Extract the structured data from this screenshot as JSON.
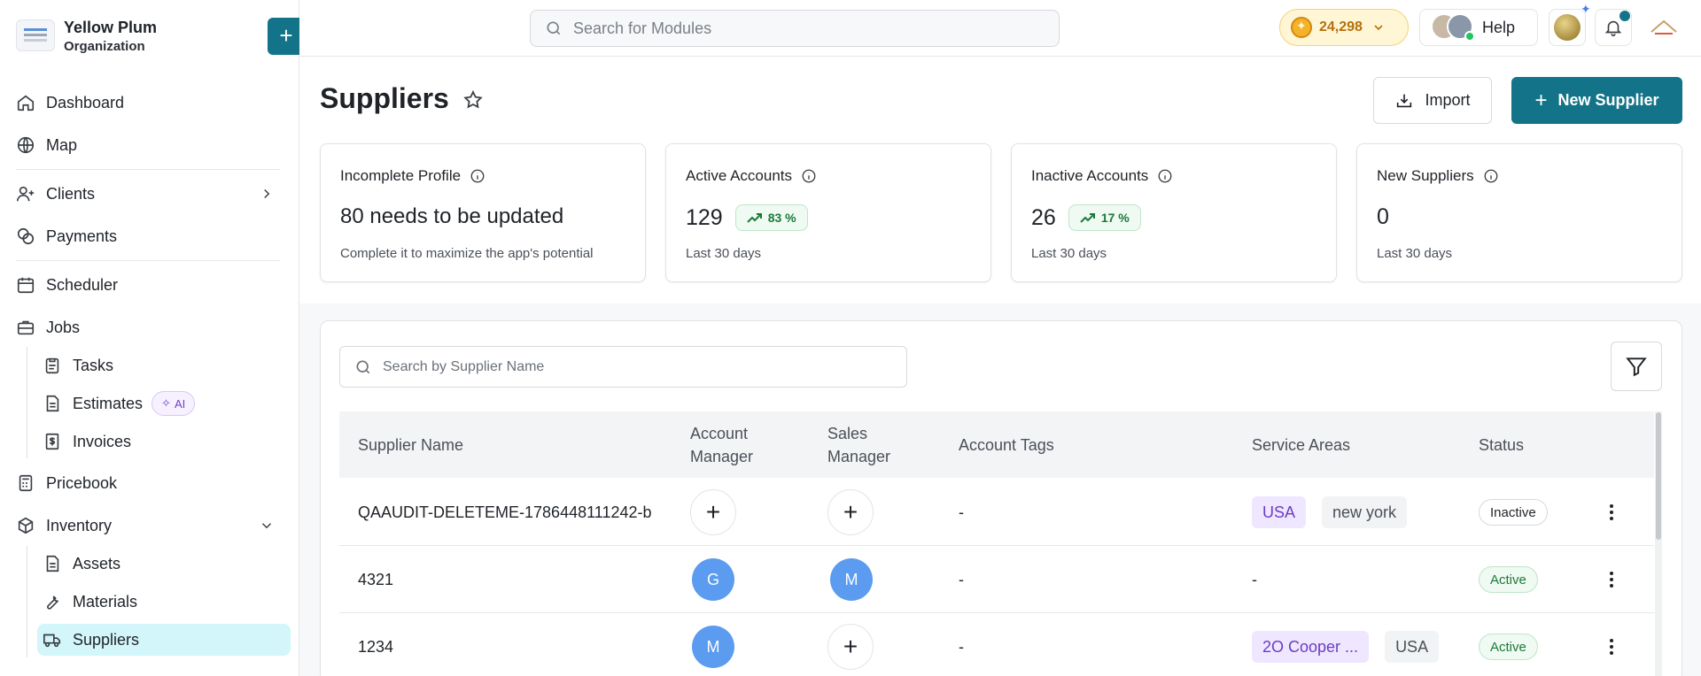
{
  "org": {
    "name": "Yellow Plum",
    "sub": "Organization"
  },
  "nav": {
    "dashboard": "Dashboard",
    "map": "Map",
    "clients": "Clients",
    "payments": "Payments",
    "scheduler": "Scheduler",
    "jobs": "Jobs",
    "tasks": "Tasks",
    "estimates": "Estimates",
    "ai_badge": "AI",
    "invoices": "Invoices",
    "pricebook": "Pricebook",
    "inventory": "Inventory",
    "assets": "Assets",
    "materials": "Materials",
    "suppliers": "Suppliers"
  },
  "topbar": {
    "search_placeholder": "Search for Modules",
    "coins": "24,298",
    "help": "Help"
  },
  "page": {
    "title": "Suppliers",
    "import_label": "Import",
    "new_label": "New Supplier"
  },
  "cards": [
    {
      "title": "Incomplete Profile",
      "value": "80 needs to be updated",
      "pct": "",
      "sub": "Complete it to maximize the app's potential"
    },
    {
      "title": "Active Accounts",
      "value": "129",
      "pct": "83 %",
      "sub": "Last 30 days"
    },
    {
      "title": "Inactive Accounts",
      "value": "26",
      "pct": "17 %",
      "sub": "Last 30 days"
    },
    {
      "title": "New Suppliers",
      "value": "0",
      "pct": "",
      "sub": "Last 30 days"
    }
  ],
  "table": {
    "search_placeholder": "Search by Supplier Name",
    "headers": {
      "name": "Supplier Name",
      "account_manager_1": "Account",
      "account_manager_2": "Manager",
      "sales_manager_1": "Sales",
      "sales_manager_2": "Manager",
      "tags": "Account Tags",
      "areas": "Service Areas",
      "status": "Status"
    },
    "rows": [
      {
        "name": "QAAUDIT-DELETEME-1786448111242-b",
        "account_manager": "+",
        "sales_manager": "+",
        "tags": "-",
        "area1": "USA",
        "area2": "new york",
        "status": "Inactive"
      },
      {
        "name": "4321",
        "account_manager": "G",
        "sales_manager": "M",
        "tags": "-",
        "area1": "-",
        "area2": "",
        "status": "Active"
      },
      {
        "name": "1234",
        "account_manager": "M",
        "sales_manager": "+",
        "tags": "-",
        "area1": "2O Cooper ...",
        "area2": "USA",
        "status": "Active"
      }
    ]
  },
  "colors": {
    "accent": "#137489",
    "active_sidebar": "#d2f6f9"
  }
}
